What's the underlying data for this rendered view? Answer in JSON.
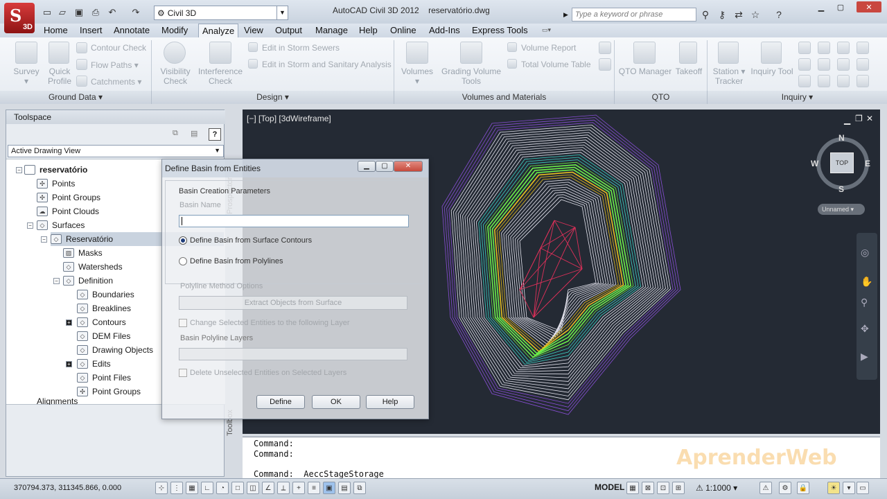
{
  "app": {
    "badge": "3D",
    "title": "AutoCAD Civil 3D 2012",
    "filename": "reservatório.dwg",
    "workspace": "Civil 3D",
    "search_placeholder": "Type a keyword or phrase"
  },
  "menu_tabs": [
    "Home",
    "Insert",
    "Annotate",
    "Modify",
    "Analyze",
    "View",
    "Output",
    "Manage",
    "Help",
    "Online",
    "Add-Ins",
    "Express Tools"
  ],
  "active_tab": "Analyze",
  "ribbon": {
    "ground_data": {
      "panel": "Ground Data",
      "survey": "Survey",
      "quick_profile_1": "Quick",
      "quick_profile_2": "Profile",
      "contour_check": "Contour Check",
      "flow_paths": "Flow Paths",
      "catchments": "Catchments"
    },
    "design": {
      "panel": "Design",
      "visibility_1": "Visibility",
      "visibility_2": "Check",
      "interference_1": "Interference",
      "interference_2": "Check",
      "edit_storm": "Edit in Storm Sewers",
      "edit_storm_sanitary": "Edit in Storm and Sanitary Analysis"
    },
    "volumes": {
      "panel": "Volumes and Materials",
      "volumes": "Volumes",
      "grading_1": "Grading Volume",
      "grading_2": "Tools",
      "volume_report": "Volume Report",
      "total_volume_table": "Total Volume Table"
    },
    "qto": {
      "panel": "QTO",
      "manager": "QTO Manager",
      "takeoff": "Takeoff"
    },
    "inquiry": {
      "panel": "Inquiry",
      "station_1": "Station",
      "station_2": "Tracker",
      "inquiry_tool": "Inquiry Tool"
    }
  },
  "toolspace": {
    "title": "Toolspace",
    "view": "Active Drawing View",
    "side_tabs": [
      "Prospector",
      "Toolbox"
    ],
    "tree": {
      "root": "reservatório",
      "points": "Points",
      "point_groups": "Point Groups",
      "point_clouds": "Point Clouds",
      "surfaces": "Surfaces",
      "surface": "Reservatório",
      "masks": "Masks",
      "watersheds": "Watersheds",
      "definition": "Definition",
      "boundaries": "Boundaries",
      "breaklines": "Breaklines",
      "contours": "Contours",
      "dem_files": "DEM Files",
      "drawing_objects": "Drawing Objects",
      "edits": "Edits",
      "point_files": "Point Files",
      "def_point_groups": "Point Groups",
      "alignments": "Alignments"
    }
  },
  "viewport": {
    "label": "[−] [Top] [3dWireframe]",
    "compass": {
      "n": "N",
      "s": "S",
      "e": "E",
      "w": "W",
      "top": "TOP"
    },
    "ucs": "Unnamed"
  },
  "dialog": {
    "title": "Define Basin from Entities",
    "group": "Basin Creation Parameters",
    "basin_name_label": "Basin Name",
    "basin_name_value": "",
    "opt_contours": "Define Basin from Surface Contours",
    "opt_polylines": "Define Basin from Polylines",
    "polyline_group": "Polyline Method Options",
    "extract_button": "Extract Objects from Surface",
    "change_layer": "Change Selected Entities to the following Layer",
    "basin_layers": "Basin Polyline Layers",
    "delete_unselected": "Delete Unselected Entities on Selected Layers",
    "define_btn": "Define",
    "ok_btn": "OK",
    "help_btn": "Help"
  },
  "command": {
    "line1": "Command:",
    "line2": "Command:",
    "current": "Command:  _AeccStageStorage"
  },
  "status": {
    "coords": "370794.373, 311345.866, 0.000",
    "model": "MODEL",
    "scale": "1:1000"
  },
  "watermark": "AprenderWeb",
  "colors": {
    "viewport_bg": "#242a34",
    "contour_white": "#e6e6f0",
    "contour_purple": "#8a4fd8",
    "contour_cyan": "#3fd6c8",
    "contour_green": "#6cf04a",
    "contour_yellow": "#e8c020",
    "contour_red": "#e0305a"
  }
}
